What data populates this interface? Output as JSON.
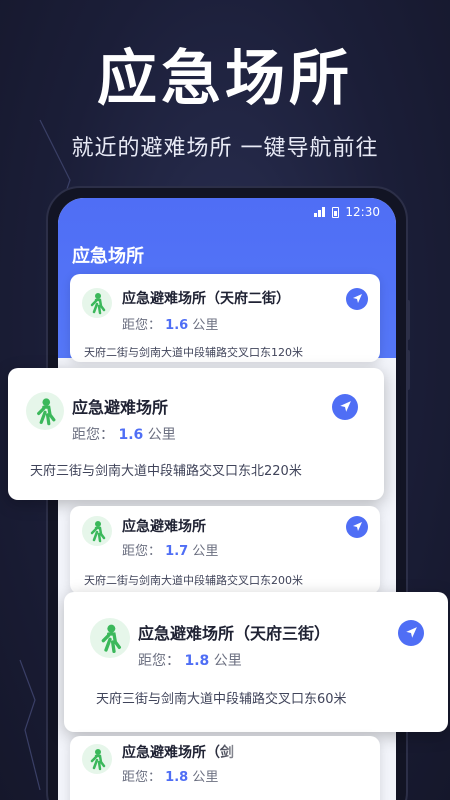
{
  "hero": {
    "title": "应急场所",
    "subtitle": "就近的避难场所 一键导航前往"
  },
  "status_bar": {
    "time": "12:30"
  },
  "screen": {
    "title": "应急场所"
  },
  "distance_label": "距您：",
  "unit": "公里",
  "cards": [
    {
      "name": "应急避难场所（天府二街）",
      "distance": "1.6",
      "address": "天府二街与剑南大道中段辅路交叉口东120米"
    },
    {
      "name": "应急避难场所",
      "distance": "1.6",
      "address": "天府三街与剑南大道中段辅路交叉口东北220米"
    },
    {
      "name": "应急避难场所",
      "distance": "1.7",
      "address": "天府二街与剑南大道中段辅路交叉口东200米"
    },
    {
      "name": "应急避难场所（天府三街）",
      "distance": "1.8",
      "address": "天府三街与剑南大道中段辅路交叉口东60米"
    },
    {
      "name": "应急避难场所（剑",
      "distance": "1.8",
      "address": ""
    }
  ],
  "colors": {
    "accent": "#4f6ef5",
    "pin_bg": "#e6f6ea",
    "pin_fg": "#3bb85b",
    "background": "#1b1e38"
  },
  "icons": {
    "pin": "walking-person-pin-icon",
    "navigate": "navigation-arrow-icon"
  }
}
